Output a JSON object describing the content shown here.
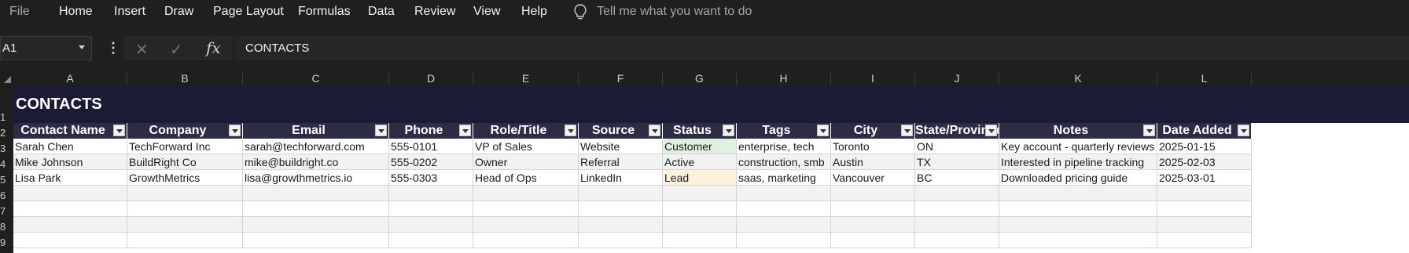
{
  "menu": {
    "file": "File",
    "items": [
      "Home",
      "Insert",
      "Draw",
      "Page Layout",
      "Formulas",
      "Data",
      "Review",
      "View",
      "Help"
    ],
    "tellme": "Tell me what you want to do"
  },
  "formula_bar": {
    "name_box": "A1",
    "formula": "CONTACTS"
  },
  "columns": [
    "A",
    "B",
    "C",
    "D",
    "E",
    "F",
    "G",
    "H",
    "I",
    "J",
    "K",
    "L"
  ],
  "rows": [
    "1",
    "2",
    "3",
    "4",
    "5",
    "6",
    "7",
    "8",
    "9"
  ],
  "sheet": {
    "title": "CONTACTS",
    "headers": [
      "Contact Name",
      "Company",
      "Email",
      "Phone",
      "Role/Title",
      "Source",
      "Status",
      "Tags",
      "City",
      "State/Province",
      "Notes",
      "Date Added"
    ],
    "records": [
      [
        "Sarah Chen",
        "TechForward Inc",
        "sarah@techforward.com",
        "555-0101",
        "VP of Sales",
        "Website",
        "Customer",
        "enterprise, tech",
        "Toronto",
        "ON",
        "Key account - quarterly reviews",
        "2025-01-15"
      ],
      [
        "Mike Johnson",
        "BuildRight Co",
        "mike@buildright.co",
        "555-0202",
        "Owner",
        "Referral",
        "Active",
        "construction, smb",
        "Austin",
        "TX",
        "Interested in pipeline tracking",
        "2025-02-03"
      ],
      [
        "Lisa Park",
        "GrowthMetrics",
        "lisa@growthmetrics.io",
        "555-0303",
        "Head of Ops",
        "LinkedIn",
        "Lead",
        "saas, marketing",
        "Vancouver",
        "BC",
        "Downloaded pricing guide",
        "2025-03-01"
      ]
    ],
    "status_colors": {
      "Customer": "#e2f0e2",
      "Active": "#f2f2f2",
      "Lead": "#fdf3dc"
    }
  },
  "colors": {
    "app_bg": "#1f1f1f",
    "title_bg": "#1b1b36",
    "header_bg": "#2c2c45",
    "stripe": "#f2f2f2"
  }
}
